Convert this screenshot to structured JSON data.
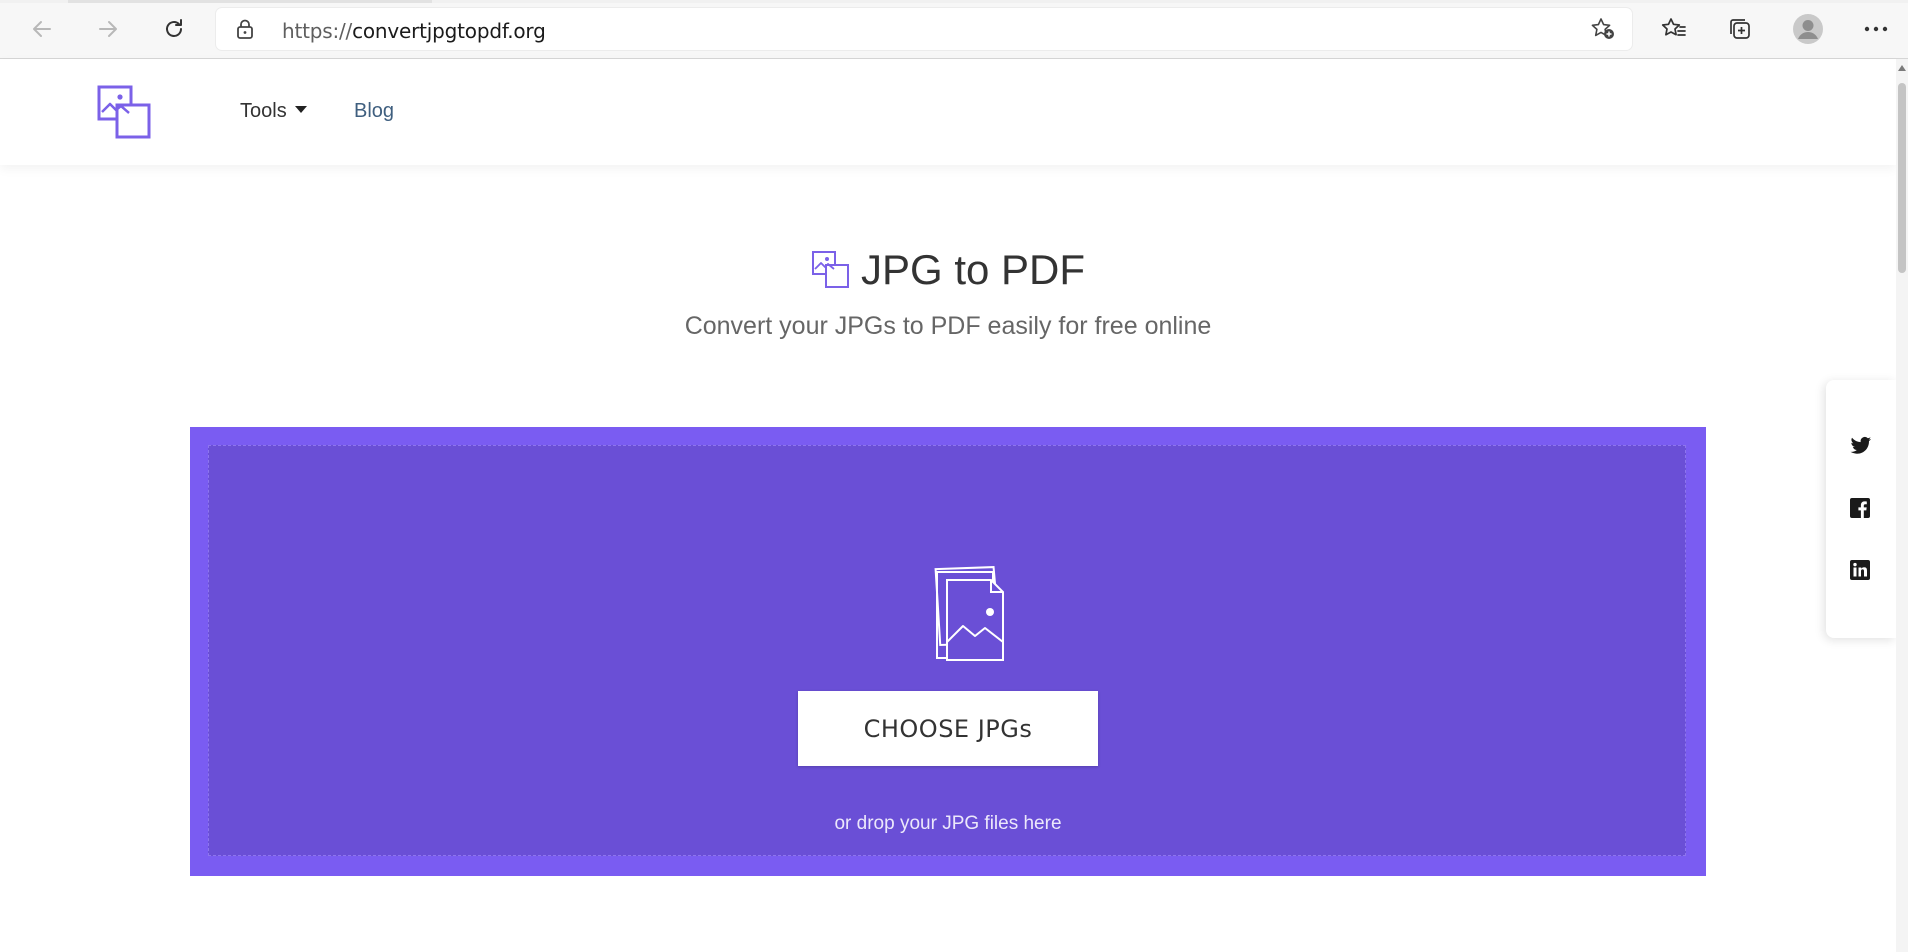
{
  "browser": {
    "url_scheme": "https://",
    "url_host": "convertjpgtopdf.org",
    "icons": {
      "back": "back-arrow-icon",
      "forward": "forward-arrow-icon",
      "refresh": "refresh-icon",
      "lock": "lock-icon",
      "add_favorite": "star-plus-icon",
      "favorites": "favorites-icon",
      "collections": "collections-icon",
      "profile": "profile-avatar-icon",
      "menu": "more-menu-icon"
    }
  },
  "site": {
    "nav": {
      "tools_label": "Tools",
      "blog_label": "Blog"
    },
    "hero": {
      "title": "JPG to PDF",
      "subtitle": "Convert your JPGs to PDF easily for free online"
    },
    "upload": {
      "button_label": "CHOOSE JPGs",
      "drop_text": "or drop your JPG files here"
    },
    "share": {
      "items": [
        "twitter-icon",
        "facebook-icon",
        "linkedin-icon"
      ]
    },
    "colors": {
      "brand": "#7a5cf2",
      "upload_inner": "#6a4fd6",
      "logo": "#7b61e8"
    }
  }
}
